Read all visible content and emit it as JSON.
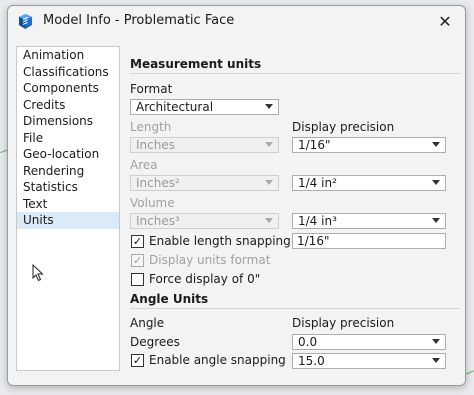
{
  "window": {
    "title": "Model Info - Problematic Face",
    "close_glyph": "✕"
  },
  "nav": {
    "items": [
      {
        "label": "Animation"
      },
      {
        "label": "Classifications"
      },
      {
        "label": "Components"
      },
      {
        "label": "Credits"
      },
      {
        "label": "Dimensions"
      },
      {
        "label": "File"
      },
      {
        "label": "Geo-location"
      },
      {
        "label": "Rendering"
      },
      {
        "label": "Statistics"
      },
      {
        "label": "Text"
      },
      {
        "label": "Units"
      }
    ],
    "selected": "Units"
  },
  "units": {
    "measurement_title": "Measurement units",
    "format_label": "Format",
    "format_value": "Architectural",
    "length_label": "Length",
    "length_value": "Inches",
    "display_precision_label": "Display precision",
    "length_precision": "1/16\"",
    "area_label": "Area",
    "area_value": "Inches²",
    "area_precision": "1/4 in²",
    "volume_label": "Volume",
    "volume_value": "Inches³",
    "volume_precision": "1/4 in³",
    "enable_length_snapping_label": "Enable length snapping",
    "enable_length_snapping_checked": true,
    "length_snapping_value": "1/16\"",
    "display_units_format_label": "Display units format",
    "display_units_format_checked": true,
    "force_display_label": "Force display of 0\"",
    "force_display_checked": false,
    "angle_title": "Angle Units",
    "angle_label": "Angle",
    "angle_precision_label": "Display precision",
    "degrees_label": "Degrees",
    "angle_precision": "0.0",
    "enable_angle_snapping_label": "Enable angle snapping",
    "enable_angle_snapping_checked": true,
    "angle_snapping_value": "15.0"
  },
  "check_glyph": "✓"
}
